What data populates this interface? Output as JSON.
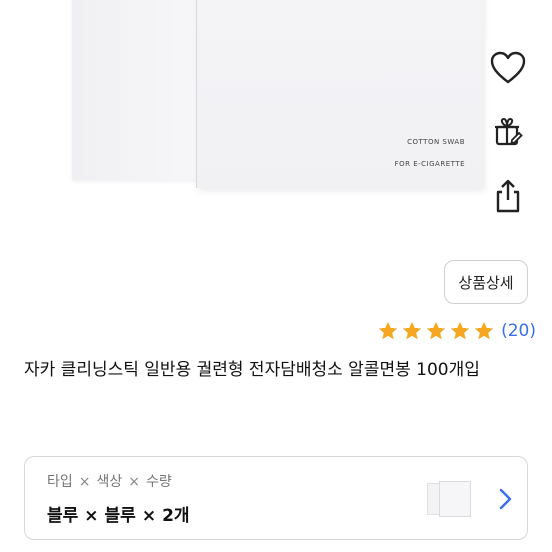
{
  "product_image": {
    "box_text_line1": "COTTON SWAB",
    "box_text_line2": "FOR E-CIGARETTE"
  },
  "side_actions": [
    {
      "icon": "heart-icon"
    },
    {
      "icon": "gift-icon"
    },
    {
      "icon": "share-icon"
    }
  ],
  "detail_button": {
    "label": "상품상세"
  },
  "rating": {
    "stars": 5,
    "count_label": "(20)",
    "star_color": "#f5a623"
  },
  "product": {
    "title": "자카 클리닝스틱 일반용 궐련형 전자담배청소 알콜면봉 100개입"
  },
  "option": {
    "labels": [
      "타입",
      "색상",
      "수량"
    ],
    "label_separator": "×",
    "values": [
      "블루",
      "블루",
      "2개"
    ],
    "value_separator": "×"
  },
  "colors": {
    "accent": "#3a6fe8"
  }
}
